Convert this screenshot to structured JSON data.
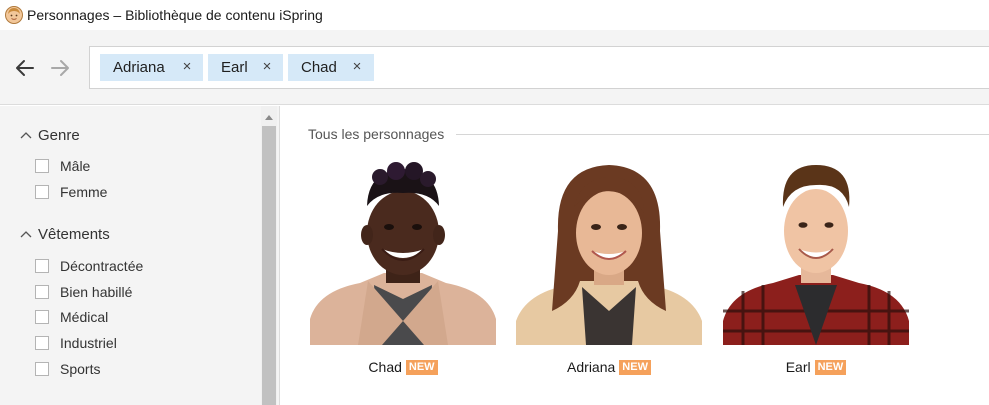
{
  "window": {
    "title": "Personnages – Bibliothèque de contenu iSpring",
    "icon": "character-avatar-icon"
  },
  "toolbar": {
    "back_icon": "arrow-left-icon",
    "forward_icon": "arrow-right-icon",
    "tags": [
      {
        "label": "Adriana",
        "close": "×"
      },
      {
        "label": "Earl",
        "close": "×"
      },
      {
        "label": "Chad",
        "close": "×"
      }
    ]
  },
  "sidebar": {
    "sections": [
      {
        "label": "Genre",
        "expanded": true,
        "items": [
          {
            "label": "Mâle",
            "checked": false
          },
          {
            "label": "Femme",
            "checked": false
          }
        ]
      },
      {
        "label": "Vêtements",
        "expanded": true,
        "items": [
          {
            "label": "Décontractée",
            "checked": false
          },
          {
            "label": "Bien habillé",
            "checked": false
          },
          {
            "label": "Médical",
            "checked": false
          },
          {
            "label": "Industriel",
            "checked": false
          },
          {
            "label": "Sports",
            "checked": false
          }
        ]
      }
    ]
  },
  "main": {
    "group_title": "Tous les personnages",
    "characters": [
      {
        "name": "Chad",
        "badge": "NEW"
      },
      {
        "name": "Adriana",
        "badge": "NEW"
      },
      {
        "name": "Earl",
        "badge": "NEW"
      }
    ]
  },
  "colors": {
    "tag_background": "#d6e9f8",
    "badge_new": "#f5a15b",
    "sidebar_background": "#f4f4f4"
  }
}
